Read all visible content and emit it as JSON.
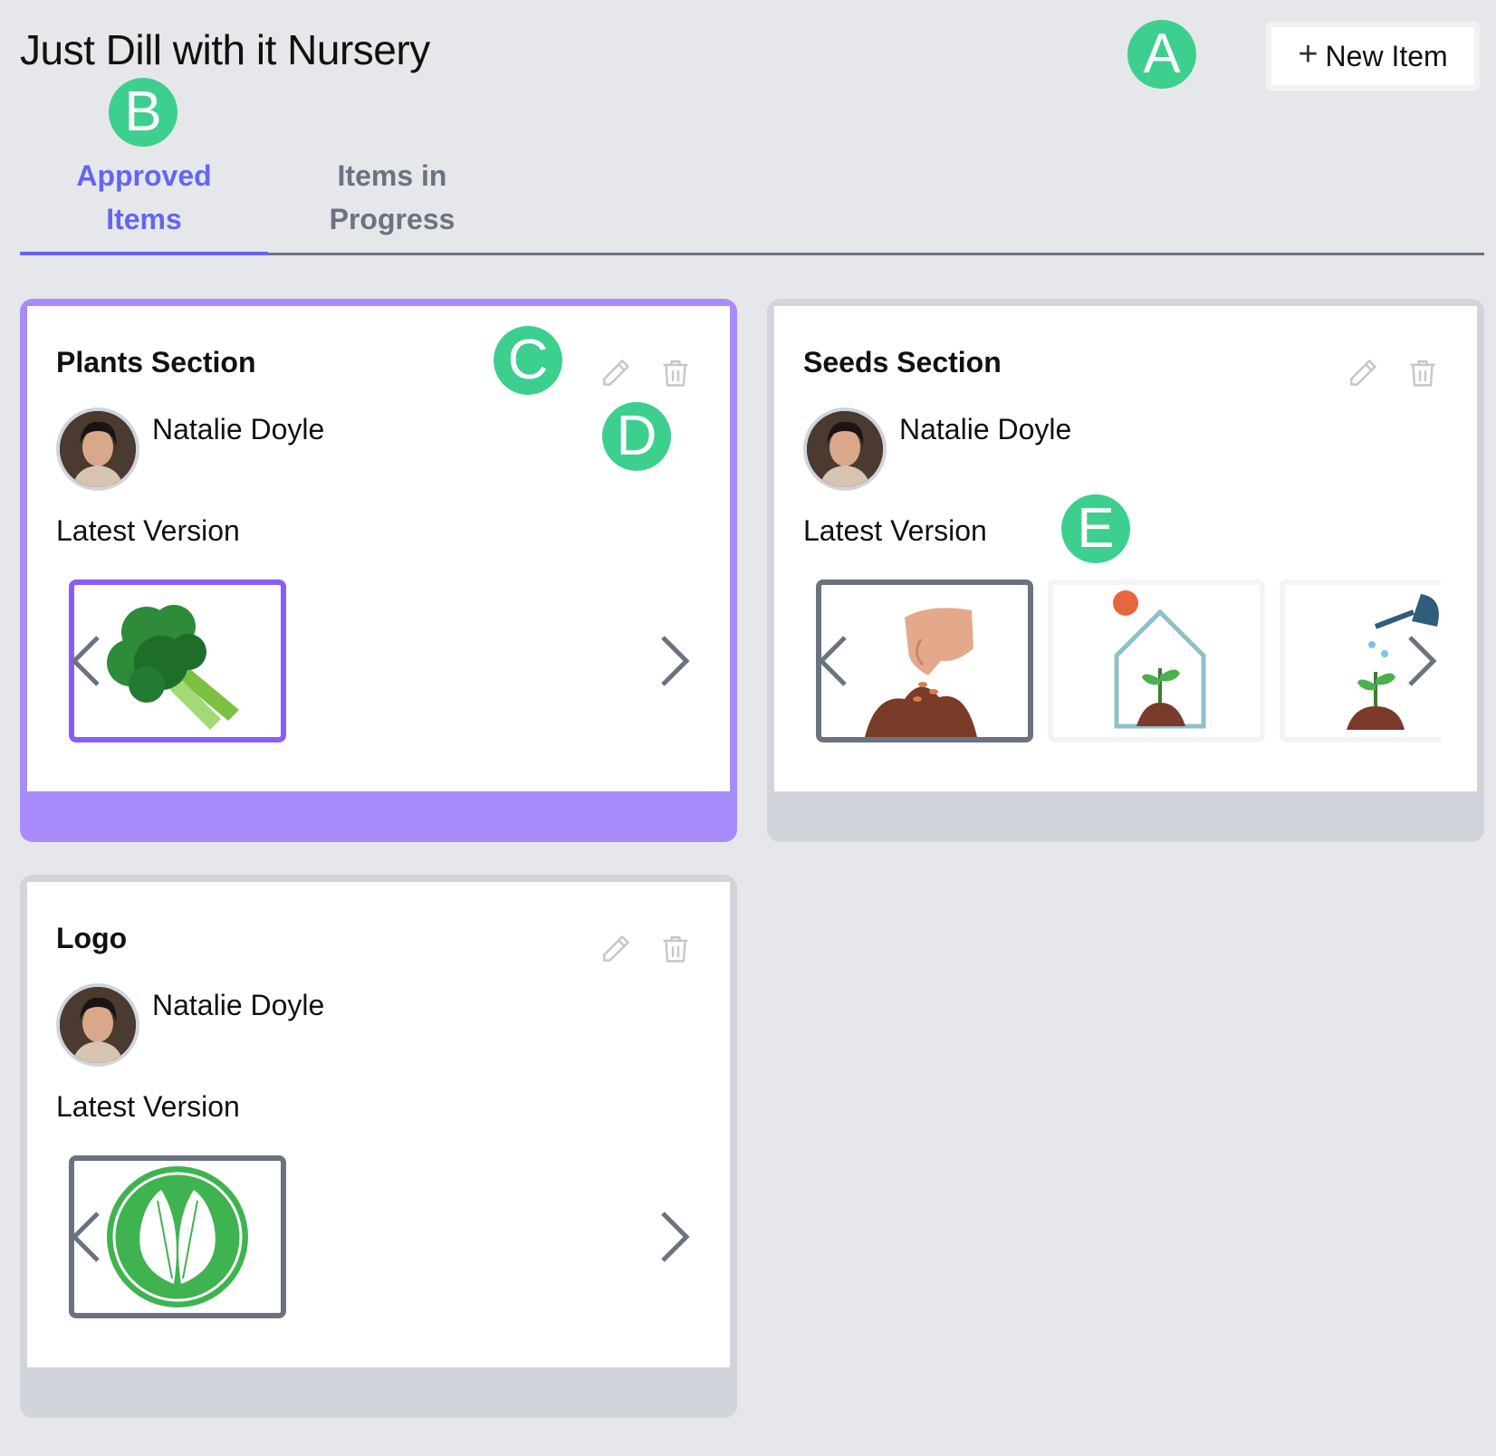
{
  "app": {
    "title": "Just Dill with it Nursery"
  },
  "toolbar": {
    "new_item_label": "New Item",
    "plus_glyph": "+"
  },
  "markers": [
    "A",
    "B",
    "C",
    "D",
    "E"
  ],
  "tabs": [
    {
      "label_line1": "Approved",
      "label_line2": "Items",
      "active": true
    },
    {
      "label_line1": "Items in",
      "label_line2": "Progress",
      "active": false
    }
  ],
  "cards": [
    {
      "title": "Plants Section",
      "author": "Natalie Doyle",
      "version_label": "Latest Version",
      "selected": true,
      "thumbnails": [
        "broccoli-illustration"
      ]
    },
    {
      "title": "Seeds Section",
      "author": "Natalie Doyle",
      "version_label": "Latest Version",
      "selected": false,
      "thumbnails": [
        "hand-sowing-seeds-illustration",
        "greenhouse-sprout-illustration",
        "watering-can-sprout-illustration"
      ]
    },
    {
      "title": "Logo",
      "author": "Natalie Doyle",
      "version_label": "Latest Version",
      "selected": false,
      "thumbnails": [
        "green-leaves-logo"
      ]
    }
  ],
  "icons": {
    "edit": "pencil-icon",
    "delete": "trash-icon",
    "prev": "chevron-left-icon",
    "next": "chevron-right-icon"
  },
  "colors": {
    "accent": "#6366f1",
    "selected_card": "#a78bfa",
    "marker": "#3dcf8e",
    "background": "#e6e7eb"
  }
}
